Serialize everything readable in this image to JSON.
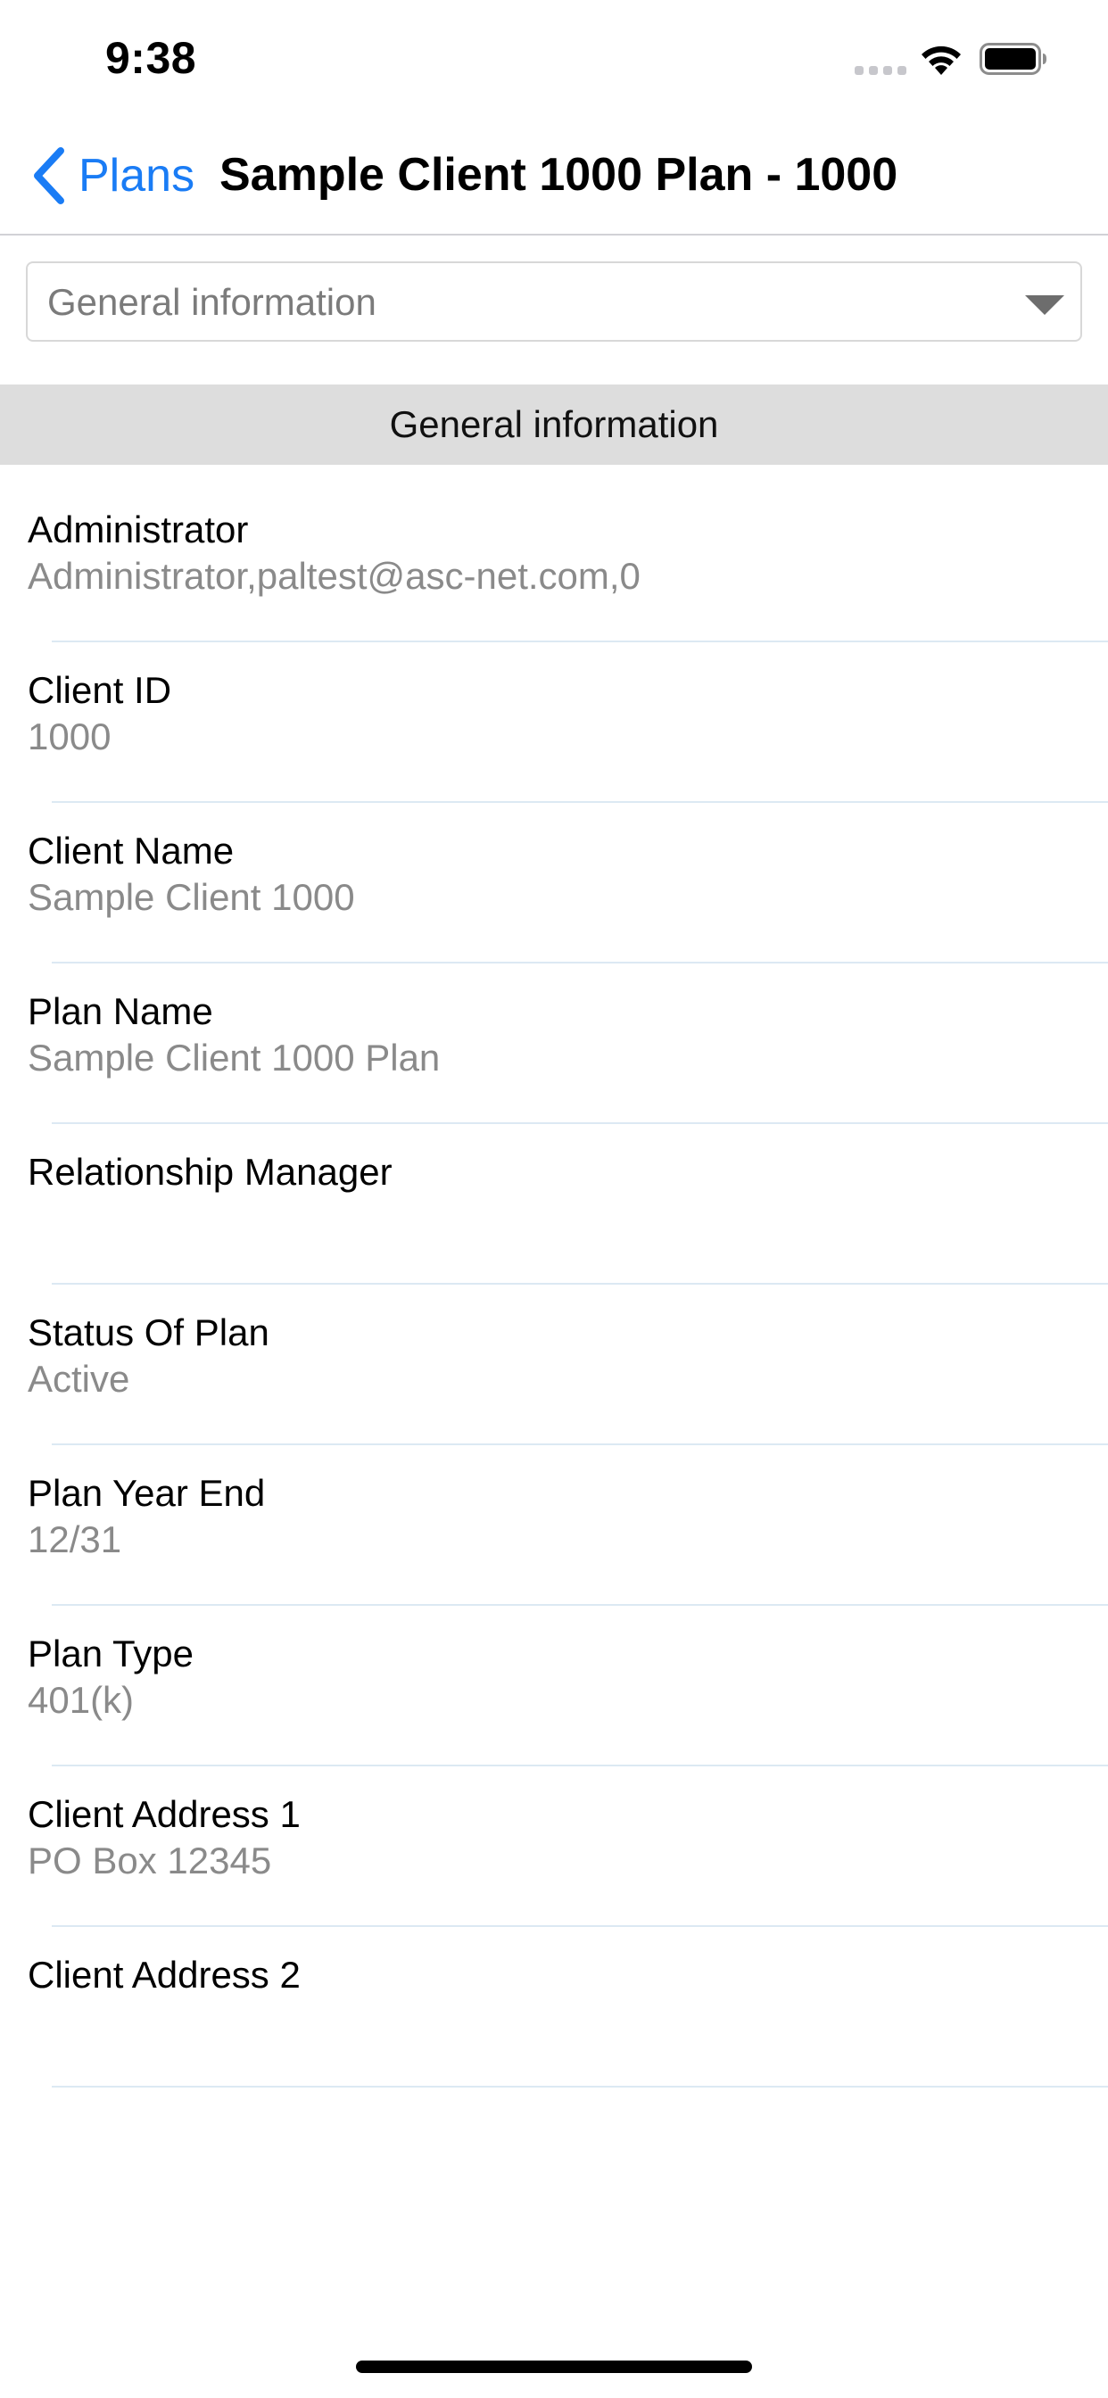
{
  "status_bar": {
    "time": "9:38",
    "icons": [
      "signal-icon",
      "wifi-icon",
      "battery-icon"
    ]
  },
  "nav": {
    "back_label": "Plans",
    "title": "Sample Client 1000 Plan - 1000"
  },
  "section_select": {
    "value": "General information"
  },
  "section_header": "General information",
  "fields": [
    {
      "label": "Administrator",
      "value": "Administrator,paltest@asc-net.com,0"
    },
    {
      "label": "Client ID",
      "value": "1000"
    },
    {
      "label": "Client Name",
      "value": "Sample Client 1000"
    },
    {
      "label": "Plan Name",
      "value": "Sample Client 1000 Plan"
    },
    {
      "label": "Relationship Manager",
      "value": ""
    },
    {
      "label": "Status Of Plan",
      "value": "Active"
    },
    {
      "label": "Plan Year End",
      "value": "12/31"
    },
    {
      "label": "Plan Type",
      "value": "401(k)"
    },
    {
      "label": "Client Address 1",
      "value": "PO Box 12345"
    },
    {
      "label": "Client Address 2",
      "value": ""
    }
  ],
  "colors": {
    "accent": "#1a7cf5",
    "secondary_text": "#8a8a8a",
    "section_header_bg": "#dddddd",
    "separator": "#dce9f3"
  }
}
